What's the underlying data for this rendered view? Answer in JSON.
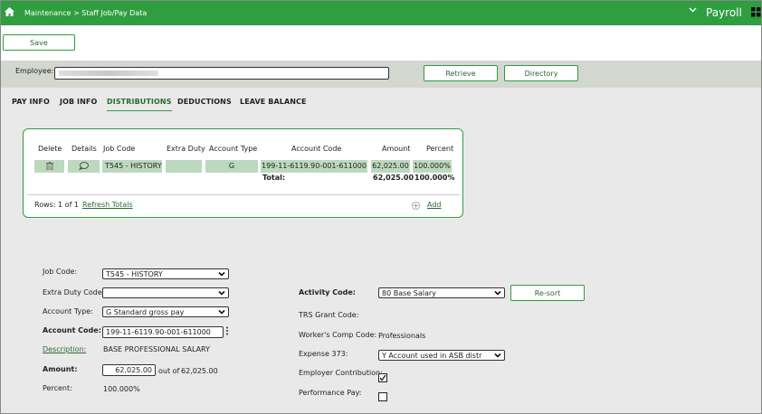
{
  "header": {
    "breadcrumb": "Maintenance > Staff Job/Pay Data",
    "app_title": "Payroll"
  },
  "toolbar": {
    "save_label": "Save"
  },
  "employee": {
    "label": "Employee:",
    "value": "",
    "retrieve_label": "Retrieve",
    "directory_label": "Directory"
  },
  "tabs": [
    {
      "label": "PAY INFO"
    },
    {
      "label": "JOB INFO"
    },
    {
      "label": "DISTRIBUTIONS"
    },
    {
      "label": "DEDUCTIONS"
    },
    {
      "label": "LEAVE BALANCE"
    }
  ],
  "grid": {
    "headers": {
      "delete": "Delete",
      "details": "Details",
      "job_code": "Job Code",
      "extra_duty": "Extra Duty",
      "account_type": "Account Type",
      "account_code": "Account Code",
      "amount": "Amount",
      "percent": "Percent"
    },
    "row": {
      "job_code": "T545 - HISTORY",
      "extra_duty": "",
      "account_type": "G",
      "account_code": "199-11-6119.90-001-611000",
      "amount": "62,025.00",
      "percent": "100.000%"
    },
    "total": {
      "label": "Total:",
      "amount": "62,025.00",
      "percent": "100.000%"
    },
    "rows_text": "Rows: 1 of 1",
    "refresh_label": "Refresh Totals",
    "add_label": "Add"
  },
  "form": {
    "job_code_label": "Job Code:",
    "job_code_value": "T545 - HISTORY",
    "extra_duty_label": "Extra Duty Code:",
    "extra_duty_value": "",
    "account_type_label": "Account Type:",
    "account_type_value": "G Standard gross pay",
    "account_code_label": "Account Code:",
    "account_code_value": "199-11-6119.90-001-611000",
    "description_label": "Description:",
    "description_value": "BASE PROFESSIONAL SALARY",
    "amount_label": "Amount:",
    "amount_value": "62,025.00",
    "out_of": "out of",
    "out_of_value": "62,025.00",
    "percent_label": "Percent:",
    "percent_value": "100.000%",
    "activity_label": "Activity Code:",
    "activity_value": "80 Base Salary",
    "resort_label": "Re-sort",
    "trs_label": "TRS Grant Code:",
    "trs_value": "",
    "workers_comp_label": "Worker's Comp Code:",
    "workers_comp_value": "Professionals",
    "expense_label": "Expense 373:",
    "expense_value": "Y Account used in ASB distr",
    "employer_contribution_label": "Employer Contribution:",
    "employer_contribution_checked": true,
    "performance_pay_label": "Performance Pay:",
    "performance_pay_checked": false
  }
}
